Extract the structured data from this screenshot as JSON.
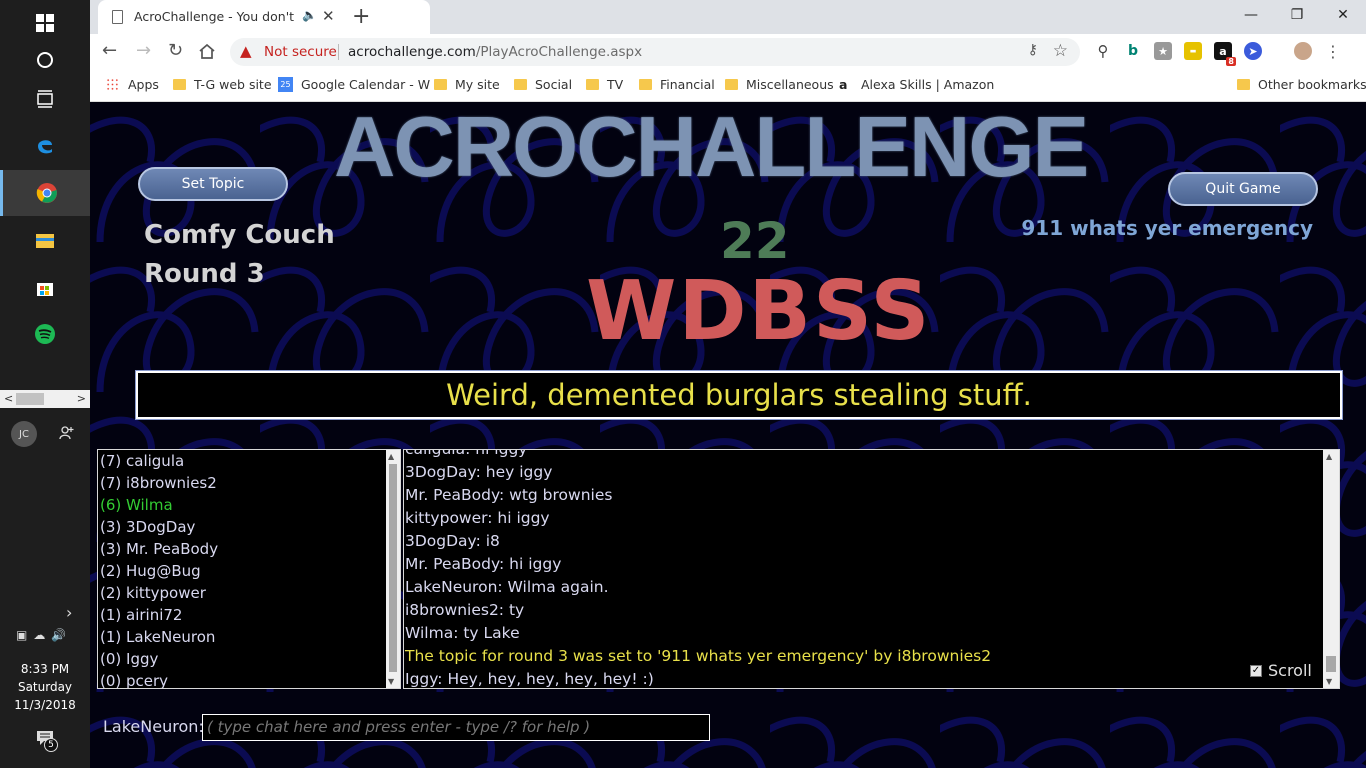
{
  "taskbar": {
    "user_initials": "JC",
    "clock_time": "8:33 PM",
    "clock_day": "Saturday",
    "clock_date": "11/3/2018",
    "notification_count": "5"
  },
  "browser": {
    "tab_title": "AcroChallenge - You don't ha",
    "security_label": "Not secure",
    "url_domain": "acrochallenge.com",
    "url_path": "/PlayAcroChallenge.aspx",
    "bookmarks": [
      {
        "label": "Apps",
        "icon": "apps-grid-icon"
      },
      {
        "label": "T-G web site",
        "icon": "folder-icon"
      },
      {
        "label": "Google Calendar - W",
        "icon": "calendar-icon"
      },
      {
        "label": "My site",
        "icon": "folder-icon"
      },
      {
        "label": "Social",
        "icon": "folder-icon"
      },
      {
        "label": "TV",
        "icon": "folder-icon"
      },
      {
        "label": "Financial",
        "icon": "folder-icon"
      },
      {
        "label": "Miscellaneous",
        "icon": "folder-icon"
      },
      {
        "label": "Alexa Skills | Amazon",
        "icon": "amazon-icon"
      }
    ],
    "other_bookmarks": "Other bookmarks",
    "calendar_day": "25",
    "extension_badge": "8"
  },
  "game": {
    "banner": "ACROCHALLENGE",
    "set_topic_button": "Set Topic",
    "quit_game_button": "Quit Game",
    "room_name": "Comfy Couch",
    "round_label": "Round 3",
    "topic": "911 whats yer emergency",
    "timer": "22",
    "acronym": "WDBSS",
    "answer": "Weird, demented burglars stealing stuff.",
    "players": [
      {
        "label": "(7) caligula",
        "highlight": false
      },
      {
        "label": "(7) i8brownies2",
        "highlight": false
      },
      {
        "label": "(6) Wilma",
        "highlight": true
      },
      {
        "label": "(3) 3DogDay",
        "highlight": false
      },
      {
        "label": "(3) Mr. PeaBody",
        "highlight": false
      },
      {
        "label": "(2) Hug@Bug",
        "highlight": false
      },
      {
        "label": "(2) kittypower",
        "highlight": false
      },
      {
        "label": "(1) airini72",
        "highlight": false
      },
      {
        "label": "(1) LakeNeuron",
        "highlight": false
      },
      {
        "label": "(0) Iggy",
        "highlight": false
      },
      {
        "label": "(0) pcery",
        "highlight": false
      }
    ],
    "chat": [
      {
        "text": "caligula: hi iggy",
        "system": false
      },
      {
        "text": "3DogDay: hey iggy",
        "system": false
      },
      {
        "text": "Mr. PeaBody: wtg brownies",
        "system": false
      },
      {
        "text": "kittypower: hi iggy",
        "system": false
      },
      {
        "text": "3DogDay: i8",
        "system": false
      },
      {
        "text": "Mr. PeaBody: hi iggy",
        "system": false
      },
      {
        "text": "LakeNeuron: Wilma again.",
        "system": false
      },
      {
        "text": "i8brownies2: ty",
        "system": false
      },
      {
        "text": "Wilma: ty Lake",
        "system": false
      },
      {
        "text": "The topic for round 3 was set to '911 whats yer emergency' by i8brownies2",
        "system": true
      },
      {
        "text": "Iggy: Hey, hey, hey, hey, hey! :)",
        "system": false
      }
    ],
    "scroll_label": "Scroll",
    "scroll_checked": true,
    "chat_user_label": "LakeNeuron:",
    "chat_placeholder": "( type chat here and press enter - type /? for help )"
  },
  "colors": {
    "acronym": "#d05a5a",
    "timer": "#4e7c57",
    "answer": "#e8e04a",
    "topic": "#7fa6d6",
    "highlight_player": "#33cc33"
  }
}
